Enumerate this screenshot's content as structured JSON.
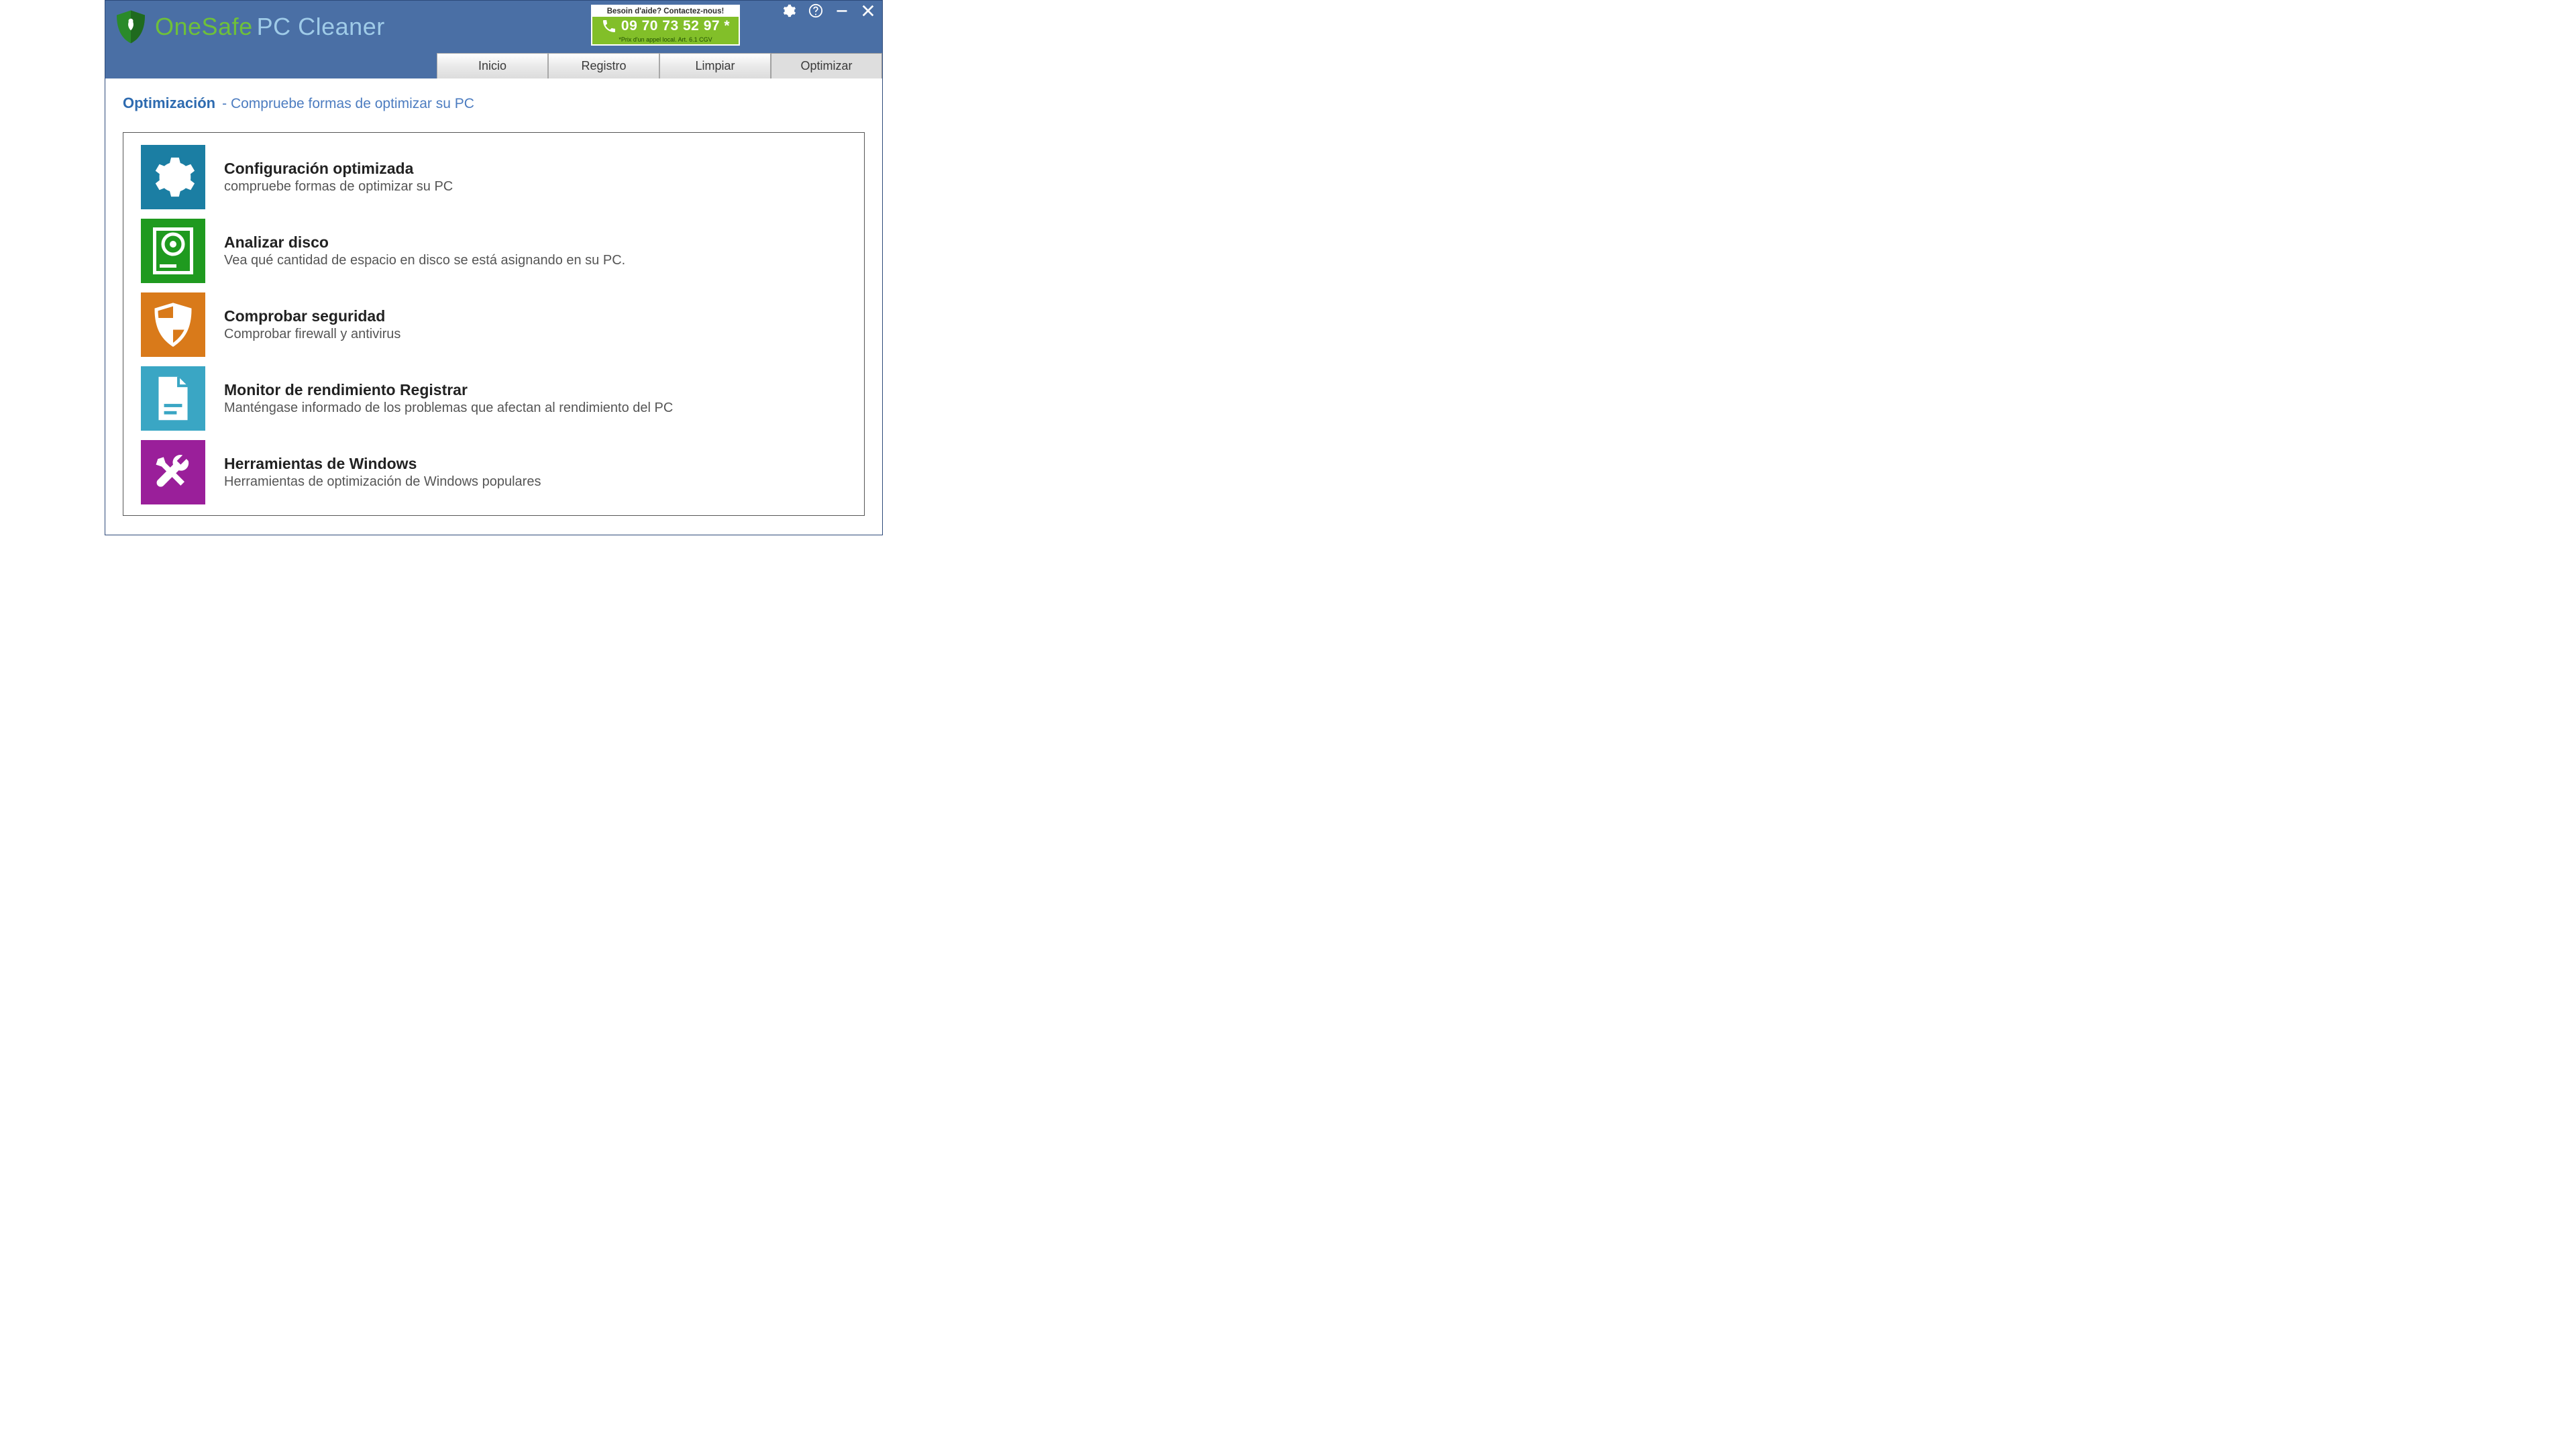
{
  "brand": {
    "one": "One",
    "safe": "Safe",
    "pc": "PC",
    "cleaner": "Cleaner"
  },
  "help": {
    "top": "Besoin d'aide? Contactez-nous!",
    "phone": "09 70 73 52 97 *",
    "bottom": "*Prix d'un appel local. Art. 6.1 CGV"
  },
  "tabs": {
    "home": "Inicio",
    "registry": "Registro",
    "clean": "Limpiar",
    "optimize": "Optimizar"
  },
  "page": {
    "title": "Optimización",
    "sep": " - ",
    "subtitle": "Compruebe formas de optimizar su PC"
  },
  "options": [
    {
      "icon": "gear-icon",
      "color": "#1b7ea3",
      "title": "Configuración optimizada",
      "desc": "compruebe formas de optimizar su PC"
    },
    {
      "icon": "disk-icon",
      "color": "#1f9a1f",
      "title": "Analizar disco",
      "desc": "Vea qué cantidad de espacio en disco se está asignando en su PC."
    },
    {
      "icon": "shield-check-icon",
      "color": "#d97a1a",
      "title": "Comprobar seguridad",
      "desc": "Comprobar firewall y antivirus"
    },
    {
      "icon": "document-icon",
      "color": "#3aa6c4",
      "title": "Monitor de rendimiento Registrar",
      "desc": "Manténgase informado de los problemas que afectan al rendimiento del PC"
    },
    {
      "icon": "tools-icon",
      "color": "#9a1f9a",
      "title": "Herramientas de Windows",
      "desc": "Herramientas de optimización de Windows populares"
    }
  ]
}
